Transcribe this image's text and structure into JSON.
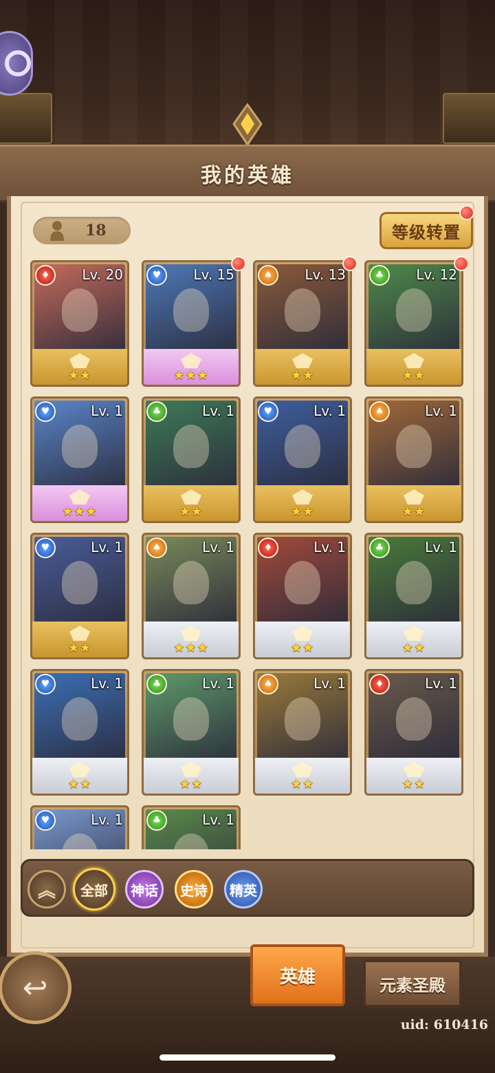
{
  "header": {
    "title": "我的英雄"
  },
  "roster": {
    "count": "18",
    "level_reset_label": "等级转置"
  },
  "heroes": [
    {
      "level": "Lv. 20",
      "element": "fire",
      "stars": "★★",
      "frame": "gold",
      "color": "#c56b5a",
      "new": false
    },
    {
      "level": "Lv. 15",
      "element": "water",
      "stars": "★★★",
      "frame": "pink",
      "color": "#4d79b8",
      "new": true
    },
    {
      "level": "Lv. 13",
      "element": "earth",
      "stars": "★★",
      "frame": "gold",
      "color": "#8a5a3a",
      "new": true
    },
    {
      "level": "Lv. 12",
      "element": "nature",
      "stars": "★★",
      "frame": "gold",
      "color": "#4f8a4a",
      "new": true
    },
    {
      "level": "Lv. 1",
      "element": "water",
      "stars": "★★★",
      "frame": "pink",
      "color": "#5a86c9",
      "new": false
    },
    {
      "level": "Lv. 1",
      "element": "nature",
      "stars": "★★",
      "frame": "gold",
      "color": "#3f7a58",
      "new": false
    },
    {
      "level": "Lv. 1",
      "element": "water",
      "stars": "★★",
      "frame": "gold",
      "color": "#3e5f9e",
      "new": false
    },
    {
      "level": "Lv. 1",
      "element": "earth",
      "stars": "★★",
      "frame": "gold",
      "color": "#a0683a",
      "new": false
    },
    {
      "level": "Lv. 1",
      "element": "water",
      "stars": "★★",
      "frame": "gold",
      "color": "#4a5d9a",
      "new": false
    },
    {
      "level": "Lv. 1",
      "element": "earth",
      "stars": "★★★",
      "frame": "silver",
      "color": "#7a8a5a",
      "new": false
    },
    {
      "level": "Lv. 1",
      "element": "fire",
      "stars": "★★",
      "frame": "silver",
      "color": "#a24a3a",
      "new": false
    },
    {
      "level": "Lv. 1",
      "element": "nature",
      "stars": "★★",
      "frame": "silver",
      "color": "#4a7a3a",
      "new": false
    },
    {
      "level": "Lv. 1",
      "element": "water",
      "stars": "★★",
      "frame": "silver",
      "color": "#3c6fb5",
      "new": false
    },
    {
      "level": "Lv. 1",
      "element": "nature",
      "stars": "★★",
      "frame": "silver",
      "color": "#5e9a6a",
      "new": false
    },
    {
      "level": "Lv. 1",
      "element": "earth",
      "stars": "★★",
      "frame": "silver",
      "color": "#9a7a3a",
      "new": false
    },
    {
      "level": "Lv. 1",
      "element": "fire",
      "stars": "★★",
      "frame": "silver",
      "color": "#6a5a4a",
      "new": false
    },
    {
      "level": "Lv. 1",
      "element": "water",
      "stars": "★★",
      "frame": "silver",
      "color": "#7a9ad0",
      "new": false
    },
    {
      "level": "Lv. 1",
      "element": "nature",
      "stars": "★★",
      "frame": "silver",
      "color": "#5a8a4a",
      "new": false
    }
  ],
  "filters": {
    "collapse_icon": "double-chevron-up-icon",
    "all": "全部",
    "mythic": "神话",
    "epic": "史诗",
    "elite": "精英"
  },
  "tabs": {
    "heroes": "英雄",
    "shrine": "元素圣殿"
  },
  "footer": {
    "uid": "uid: 610416"
  }
}
